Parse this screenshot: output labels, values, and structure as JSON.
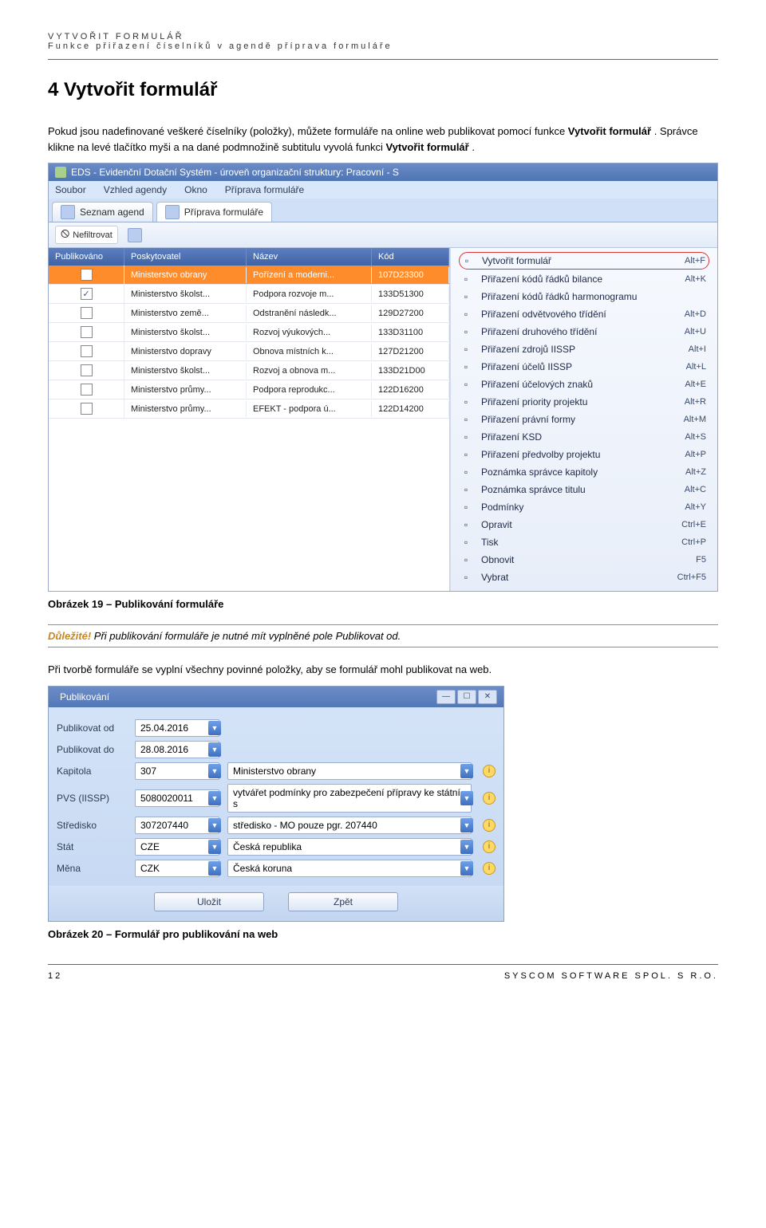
{
  "header": {
    "line1": "VYTVOŘIT FORMULÁŘ",
    "line2": "Funkce přiřazení číselníků v agendě příprava formuláře"
  },
  "heading": "4 Vytvořit formulář",
  "intro": {
    "p1a": "Pokud jsou nadefinované veškeré číselníky (položky), můžete formuláře na online web publikovat pomocí funkce ",
    "p1b": "Vytvořit formulář",
    "p1c": ". Správce klikne na levé tlačítko myši a na dané podmnožině subtitulu vyvolá funkci ",
    "p1d": "Vytvořit formulář",
    "p1e": "."
  },
  "app": {
    "title": "EDS - Evidenční Dotační Systém - úroveň organizační struktury: Pracovní - S",
    "menu": [
      "Soubor",
      "Vzhled agendy",
      "Okno",
      "Příprava formuláře"
    ],
    "tabs": [
      "Seznam agend",
      "Příprava formuláře"
    ],
    "filter": "Nefiltrovat",
    "gridHead": [
      "Publikováno",
      "Poskytovatel",
      "Název",
      "Kód"
    ],
    "rows": [
      {
        "pub": false,
        "posk": "Ministerstvo obrany",
        "nazev": "Pořízení a moderni...",
        "kod": "107D23300",
        "sel": true
      },
      {
        "pub": true,
        "posk": "Ministerstvo školst...",
        "nazev": "Podpora rozvoje m...",
        "kod": "133D51300"
      },
      {
        "pub": false,
        "posk": "Ministerstvo země...",
        "nazev": "Odstranění následk...",
        "kod": "129D27200"
      },
      {
        "pub": false,
        "posk": "Ministerstvo školst...",
        "nazev": "Rozvoj výukových...",
        "kod": "133D31100"
      },
      {
        "pub": false,
        "posk": "Ministerstvo dopravy",
        "nazev": "Obnova místních k...",
        "kod": "127D21200"
      },
      {
        "pub": false,
        "posk": "Ministerstvo školst...",
        "nazev": "Rozvoj a obnova m...",
        "kod": "133D21D00"
      },
      {
        "pub": false,
        "posk": "Ministerstvo průmy...",
        "nazev": "Podpora reprodukc...",
        "kod": "122D16200"
      },
      {
        "pub": false,
        "posk": "Ministerstvo průmy...",
        "nazev": "EFEKT - podpora ú...",
        "kod": "122D14200"
      }
    ],
    "ctx": [
      {
        "label": "Vytvořit formulář",
        "short": "Alt+F",
        "hl": true
      },
      {
        "label": "Přiřazení kódů řádků bilance",
        "short": "Alt+K"
      },
      {
        "label": "Přiřazení kódů řádků harmonogramu",
        "short": ""
      },
      {
        "label": "Přiřazení odvětvového třídění",
        "short": "Alt+D"
      },
      {
        "label": "Přiřazení druhového třídění",
        "short": "Alt+U"
      },
      {
        "label": "Přiřazení zdrojů IISSP",
        "short": "Alt+I"
      },
      {
        "label": "Přiřazení účelů IISSP",
        "short": "Alt+L"
      },
      {
        "label": "Přiřazení účelových znaků",
        "short": "Alt+E"
      },
      {
        "label": "Přiřazení priority projektu",
        "short": "Alt+R"
      },
      {
        "label": "Přiřazení právní formy",
        "short": "Alt+M"
      },
      {
        "label": "Přiřazení KSD",
        "short": "Alt+S"
      },
      {
        "label": "Přiřazení předvolby projektu",
        "short": "Alt+P"
      },
      {
        "label": "Poznámka správce kapitoly",
        "short": "Alt+Z"
      },
      {
        "label": "Poznámka správce titulu",
        "short": "Alt+C"
      },
      {
        "label": "Podmínky",
        "short": "Alt+Y"
      },
      {
        "label": "Opravit",
        "short": "Ctrl+E"
      },
      {
        "label": "Tisk",
        "short": "Ctrl+P"
      },
      {
        "label": "Obnovit",
        "short": "F5"
      },
      {
        "label": "Vybrat",
        "short": "Ctrl+F5"
      }
    ]
  },
  "caption1": "Obrázek 19 – Publikování formuláře",
  "note": {
    "label": "Důležité!",
    "text": " Při publikování formuláře je nutné mít vyplněné pole Publikovat od."
  },
  "p2": "Při tvorbě formuláře se vyplní všechny povinné položky, aby se formulář mohl publikovat na web.",
  "dlg": {
    "title": "Publikování",
    "fields": [
      {
        "label": "Publikovat od",
        "val": "25.04.2016",
        "desc": ""
      },
      {
        "label": "Publikovat do",
        "val": "28.08.2016",
        "desc": ""
      },
      {
        "label": "Kapitola",
        "val": "307",
        "desc": "Ministerstvo obrany"
      },
      {
        "label": "PVS (IISSP)",
        "val": "5080020011",
        "desc": "vytvářet podmínky pro zabezpečení přípravy ke státní s"
      },
      {
        "label": "Středisko",
        "val": "307207440",
        "desc": "středisko - MO pouze pgr. 207440"
      },
      {
        "label": "Stát",
        "val": "CZE",
        "desc": "Česká republika"
      },
      {
        "label": "Měna",
        "val": "CZK",
        "desc": "Česká koruna"
      }
    ],
    "buttons": {
      "save": "Uložit",
      "back": "Zpět"
    }
  },
  "caption2": "Obrázek 20 – Formulář pro publikování na web",
  "footer": {
    "page": "12",
    "org": "SYSCOM SOFTWARE SPOL. S R.O."
  }
}
